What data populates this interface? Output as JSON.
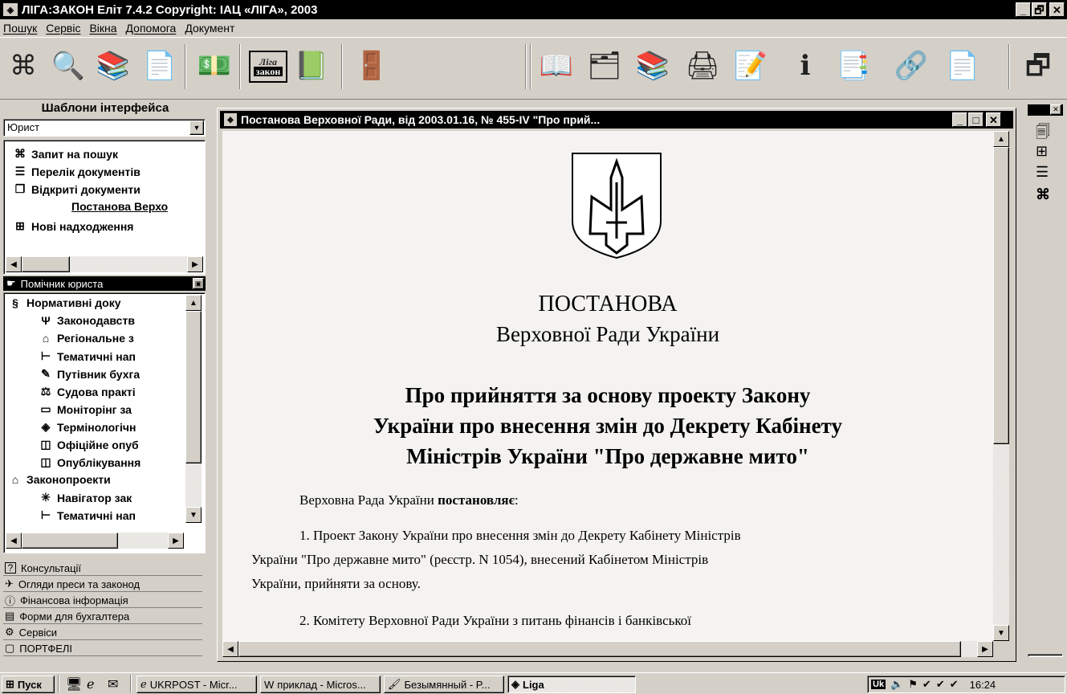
{
  "app": {
    "title": "ЛІГА:ЗАКОН Еліт 7.4.2 Copyright: ІАЦ «ЛІГА», 2003",
    "minimize": "_",
    "maximize": "🗗",
    "close": "✕"
  },
  "menu": [
    "Пошук",
    "Сервіс",
    "Вікна",
    "Допомога",
    "Документ"
  ],
  "toolbar_logo": {
    "line1": "Ліга",
    "line2": "закон"
  },
  "left_panel": {
    "templates_title": "Шаблони інтерфейса",
    "template_select": "Юрист",
    "tree1": [
      {
        "label": "Запит на пошук",
        "icon": "binoculars-icon"
      },
      {
        "label": "Перелік документів",
        "icon": "list-icon"
      },
      {
        "label": "Відкриті документи",
        "icon": "windows-icon"
      },
      {
        "label": "Постанова Верхо",
        "icon": ""
      },
      {
        "label": "Нові надходження",
        "icon": "new-docs-icon"
      }
    ],
    "assistant_header": "Помічник юриста",
    "tree2": [
      {
        "label": "Нормативні доку",
        "icon": "paragraph-icon"
      },
      {
        "label": "Законодавств",
        "icon": "trident-icon"
      },
      {
        "label": "Регіональне з",
        "icon": "map-icon"
      },
      {
        "label": "Тематичні нап",
        "icon": "tree-icon"
      },
      {
        "label": "Путівник бухга",
        "icon": "pen-icon"
      },
      {
        "label": "Судова практі",
        "icon": "scales-icon"
      },
      {
        "label": "Моніторінг за",
        "icon": "monitor-icon"
      },
      {
        "label": "Термінологічн",
        "icon": "book-icon"
      },
      {
        "label": "Офіційне опуб",
        "icon": "open-book-icon"
      },
      {
        "label": "Опублікування",
        "icon": "open-book-icon"
      },
      {
        "label": "Законопроекти",
        "icon": "building-icon"
      },
      {
        "label": "Навігатор зак",
        "icon": "star-icon"
      },
      {
        "label": "Тематичні нап",
        "icon": "tree-icon"
      }
    ],
    "nav_buttons": [
      {
        "label": "Консультації",
        "icon": "question-icon"
      },
      {
        "label": "Огляди преси та законод",
        "icon": "press-icon"
      },
      {
        "label": "Фінансова інформація",
        "icon": "info-icon"
      },
      {
        "label": "Форми для бухгалтера",
        "icon": "forms-icon"
      },
      {
        "label": "Сервіси",
        "icon": "services-icon"
      },
      {
        "label": "ПОРТФЕЛІ",
        "icon": "portfolio-icon"
      }
    ]
  },
  "document": {
    "window_title": "Постанова Верховної Ради, від 2003.01.16, № 455-IV \"Про прий...",
    "heading1": "ПОСТАНОВА",
    "heading2": "Верховної Ради України",
    "subject_line1": "Про прийняття за основу проекту Закону",
    "subject_line2": "України про внесення змін до Декрету Кабінету",
    "subject_line3": "Міністрів України \"Про державне мито\"",
    "intro_plain": "Верховна Рада України ",
    "intro_bold": "постановляє",
    "intro_end": ":",
    "p1_line1": "1. Проект Закону України про внесення змін до Декрету Кабінету  Міністрів",
    "p1_line2": "України \"Про державне мито\" (реєстр. N 1054), внесений Кабінетом  Міністрів",
    "p1_line3": "України, прийняти за основу.",
    "p2_line1": "2.  Комітету  Верховної  Ради  України  з  питань  фінансів  і  банківської"
  },
  "taskbar": {
    "start": "Пуск",
    "tasks": [
      "UKRPOST - Micr...",
      "приклад - Micros...",
      "Безымянный - P...",
      "Liga"
    ],
    "lang": "Uk",
    "clock": "16:24"
  }
}
